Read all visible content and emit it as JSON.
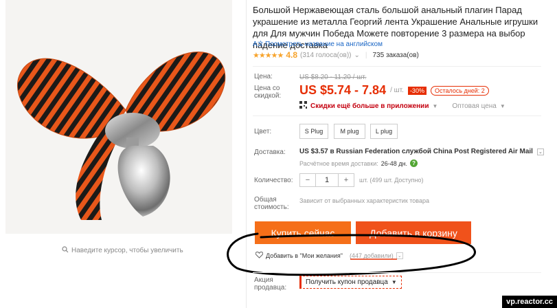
{
  "product": {
    "title": "Большой Нержавеющая сталь большой анальный плагин Парад украшение из металла Георгий лента Украшение Анальные игрушки для Для мужчин Победа Можете повторение 3 размера на выбор падение доставка",
    "translate_link": "Посмотреть название на английском",
    "rating": "4.8",
    "votes": "(314 голоса(ов))",
    "orders": "735 заказа(ов)"
  },
  "gallery": {
    "zoom_hint": "Наведите курсор, чтобы увеличить"
  },
  "price": {
    "label": "Цена:",
    "old": "US $8.20 - 11.20 / шт.",
    "discount_label": "Цена со скидкой:",
    "current": "US $5.74 - 7.84",
    "per_unit": "/ шт.",
    "discount": "-30%",
    "days_left": "Осталось дней: 2",
    "app_link": "Скидки ещё больше в приложении",
    "wholesale": "Оптовая цена"
  },
  "color": {
    "label": "Цвет:",
    "options": [
      "S Plug",
      "M plug",
      "L plug"
    ]
  },
  "shipping": {
    "label": "Доставка:",
    "text": "US $3.57 в Russian Federation службой China Post Registered Air Mail",
    "eta_label": "Расчётное время доставки:",
    "eta_value": "26-48 дн."
  },
  "quantity": {
    "label": "Количество:",
    "minus": "−",
    "value": "1",
    "plus": "+",
    "note": "шт. (499 шт. Доступно)"
  },
  "total": {
    "label": "Общая стоимость:",
    "value": "Зависит от выбранных характеристик товара"
  },
  "actions": {
    "buy_now": "Купить сейчас",
    "add_to_cart": "Добавить в корзину",
    "wishlist": "Добавить в \"Мои желания\"",
    "wishlist_count": "(447 добавили)"
  },
  "promo": {
    "label": "Акция продавца:",
    "coupon": "Получить купон продавца"
  },
  "watermark": "vp.reactor.cc",
  "colors": {
    "accent_red": "#e62e04",
    "buy_orange": "#f56f19",
    "cart_orange": "#f0521b",
    "star": "#f7a32b",
    "link_blue": "#1a66c5"
  }
}
